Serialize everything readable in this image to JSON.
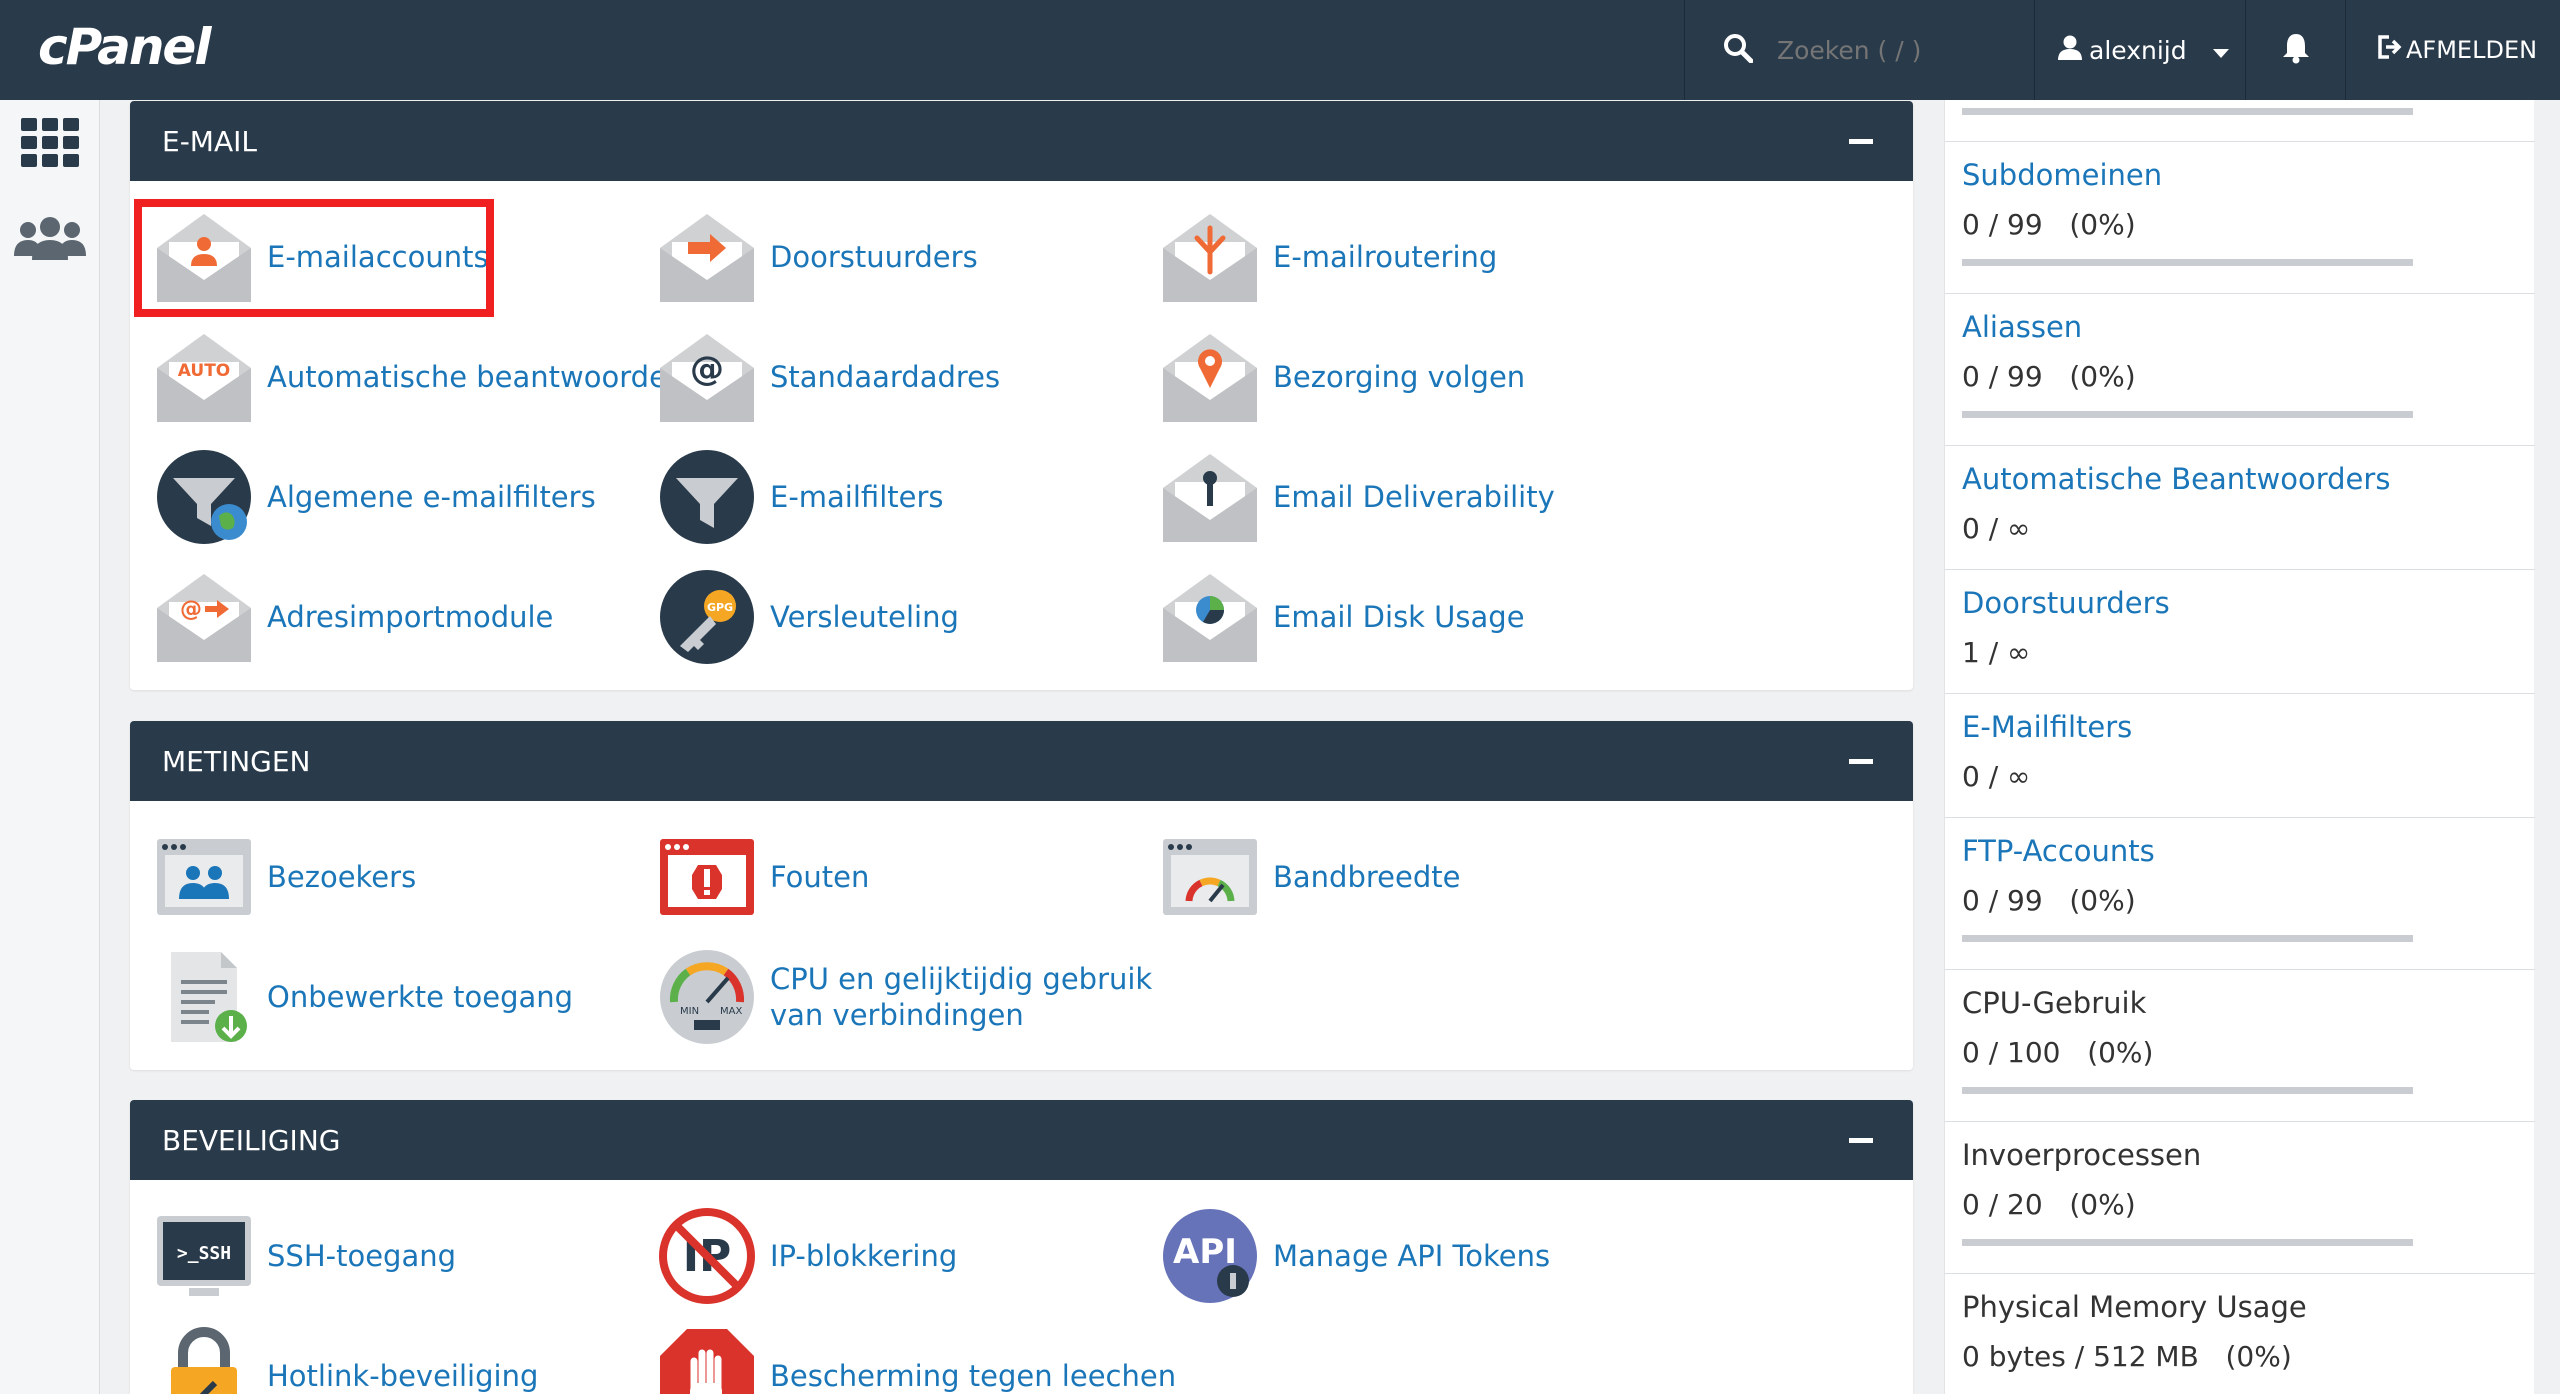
{
  "brand": "cPanel",
  "topbar": {
    "search_placeholder": "Zoeken ( / )",
    "username": "alexnijd",
    "logout_label": "AFMELDEN"
  },
  "sections": [
    {
      "title": "E-MAIL",
      "items": [
        "E-mailaccounts",
        "Doorstuurders",
        "E-mailroutering",
        "Automatische beantwoorders",
        "Standaardadres",
        "Bezorging volgen",
        "Algemene e-mailfilters",
        "E-mailfilters",
        "Email Deliverability",
        "Adresimportmodule",
        "Versleuteling",
        "Email Disk Usage"
      ]
    },
    {
      "title": "METINGEN",
      "items": [
        "Bezoekers",
        "Fouten",
        "Bandbreedte",
        "Onbewerkte toegang",
        "CPU en gelijktijdig gebruik",
        "van verbindingen"
      ]
    },
    {
      "title": "BEVEILIGING",
      "items": [
        "SSH-toegang",
        "IP-blokkering",
        "Manage API Tokens",
        "Hotlink-beveiliging",
        "Bescherming tegen leechen"
      ]
    }
  ],
  "stats": [
    {
      "title": "Subdomeinen",
      "value": "0 / 99   (0%)",
      "percent": 0
    },
    {
      "title": "Aliassen",
      "value": "0 / 99   (0%)",
      "percent": 0
    },
    {
      "title": "Automatische Beantwoorders",
      "value": "0 / ∞"
    },
    {
      "title": "Doorstuurders",
      "value": "1 / ∞"
    },
    {
      "title": "E-Mailfilters",
      "value": "0 / ∞"
    },
    {
      "title": "FTP-Accounts",
      "value": "0 / 99   (0%)",
      "percent": 0
    },
    {
      "title": "CPU-Gebruik",
      "value": "0 / 100   (0%)",
      "percent": 0
    },
    {
      "title": "Invoerprocessen",
      "value": "0 / 20   (0%)",
      "percent": 0
    },
    {
      "title": "Physical Memory Usage",
      "value": "0 bytes / 512 MB   (0%)",
      "percent": 0
    }
  ],
  "colors": {
    "nav": "#293a4a",
    "link": "#1a76b8",
    "accent": "#f06a35",
    "highlight": "#f02020"
  }
}
